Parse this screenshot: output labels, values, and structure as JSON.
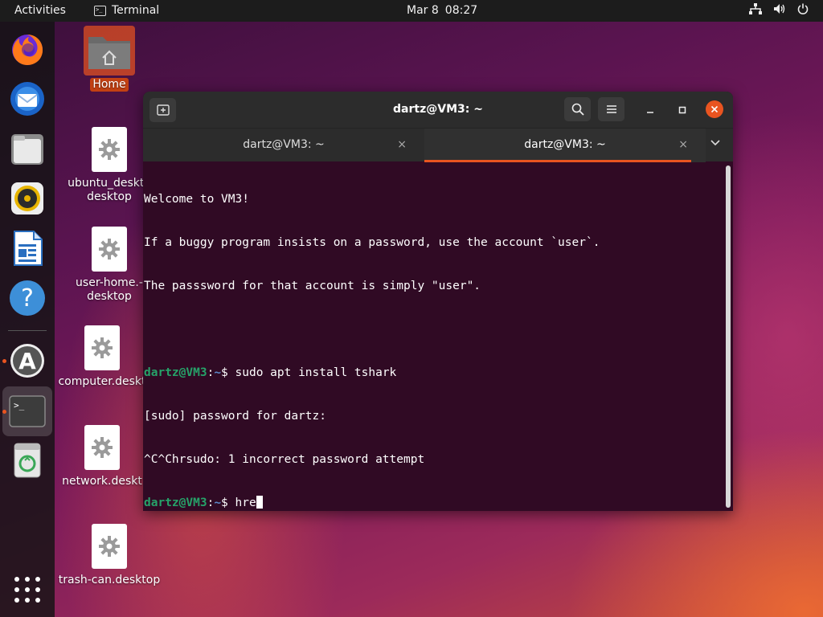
{
  "topbar": {
    "activities": "Activities",
    "app_name": "Terminal",
    "date": "Mar 8",
    "time": "08:27"
  },
  "dock": {
    "items": [
      "firefox-icon",
      "thunderbird-icon",
      "files-icon",
      "rhythmbox-icon",
      "writer-icon",
      "help-icon",
      "software-icon",
      "terminal-icon",
      "trash-icon"
    ]
  },
  "desktop": {
    "icons": [
      {
        "label": "Home"
      },
      {
        "label": "ubuntu_deskto\ndesktop"
      },
      {
        "label": "user-home.-\ndesktop"
      },
      {
        "label": "computer.deskt"
      },
      {
        "label": "network.deskt"
      },
      {
        "label": "trash-can.desktop"
      }
    ]
  },
  "terminal": {
    "title": "dartz@VM3: ~",
    "tabs": [
      {
        "label": "dartz@VM3: ~",
        "close": "×"
      },
      {
        "label": "dartz@VM3: ~",
        "close": "×"
      }
    ],
    "lines": {
      "l1": "Welcome to VM3!",
      "l2": "If a buggy program insists on a password, use the account `user`.",
      "l3": "The passsword for that account is simply \"user\".",
      "p1_user": "dartz@VM3",
      "p1_sep": ":",
      "p1_path": "~",
      "p1_cmd": "$ sudo apt install tshark",
      "l5": "[sudo] password for dartz:",
      "l6": "^C^Chrsudo: 1 incorrect password attempt",
      "p2_user": "dartz@VM3",
      "p2_sep": ":",
      "p2_path": "~",
      "p2_cmd": "$ hre"
    }
  },
  "colors": {
    "accent": "#e95420",
    "terminal_bg": "#300a24",
    "prompt_user": "#26a269",
    "prompt_path": "#5c8ac9"
  }
}
